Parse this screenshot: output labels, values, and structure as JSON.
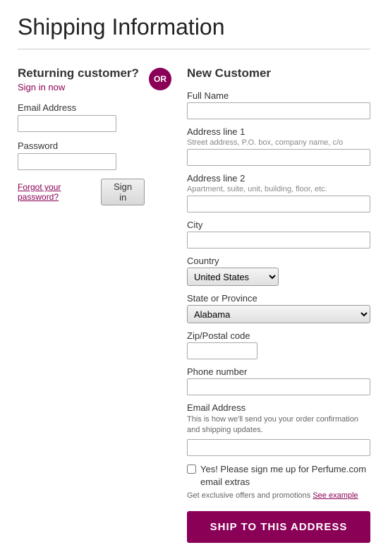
{
  "page": {
    "title": "Shipping Information"
  },
  "left": {
    "returning_title": "Returning customer?",
    "sign_in_link": "Sign in now",
    "email_label": "Email Address",
    "password_label": "Password",
    "forgot_label": "Forgot your password?",
    "sign_in_btn": "Sign in"
  },
  "or_badge": "OR",
  "right": {
    "new_customer_title": "New Customer",
    "full_name_label": "Full Name",
    "address1_label": "Address line 1",
    "address1_sub": "Street address, P.O. box, company name, c/o",
    "address2_label": "Address line 2",
    "address2_sub": "Apartment, suite, unit, building, floor, etc.",
    "city_label": "City",
    "country_label": "Country",
    "country_value": "United States",
    "state_label": "State or Province",
    "state_value": "Alabama",
    "zip_label": "Zip/Postal code",
    "phone_label": "Phone number",
    "email_label": "Email Address",
    "email_sub": "This is how we'll send you your order confirmation and shipping updates.",
    "checkbox_label": "Yes! Please sign me up for Perfume.com email extras",
    "get_exclusive": "Get exclusive offers and promotions",
    "see_example": "See example",
    "ship_btn": "SHIP TO THIS ADDRESS"
  }
}
